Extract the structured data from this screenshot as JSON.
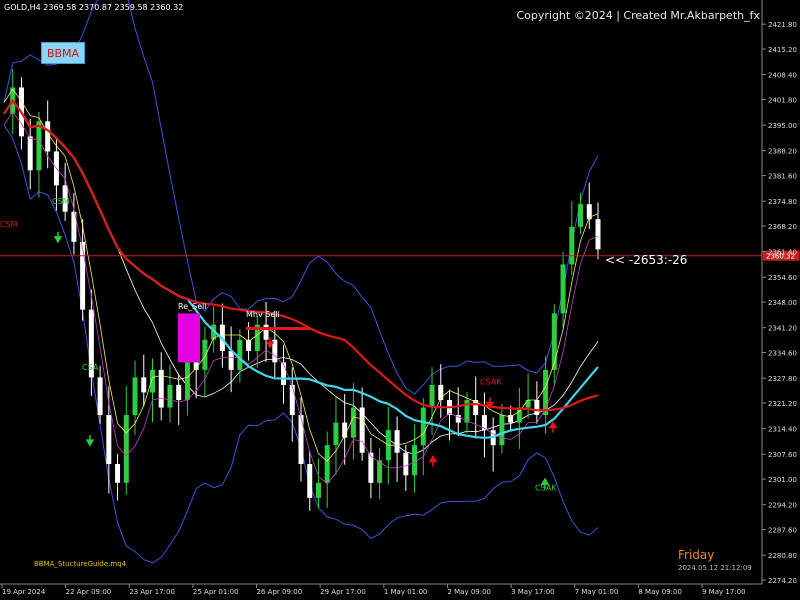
{
  "header": {
    "ohlc": "GOLD,H4 2369.58 2370.87 2359.58 2360.32",
    "copyright": "Copyright ©2024 | Created Mr.Akbarpeth_fx"
  },
  "bbma_button": "BBMA",
  "ea_name": "BBMA_StuctureGuide.mq4",
  "day_label": "Friday",
  "timestamp": "2024.05.12 21:12:09",
  "readout": "<< -2653:-26",
  "current_price": "2360.32",
  "colors": {
    "background": "#000000",
    "bull_candle": "#2ecc40",
    "bear_candle": "#ffffff",
    "bollinger": "#3a55d8",
    "ema50": "#40d8e8",
    "ma_long": "#e01818",
    "ma_fast_high": "#f0f060",
    "ma_fast_low": "#c040c0",
    "price_line": "#c81e1e"
  },
  "chart_data": {
    "type": "candlestick",
    "symbol": "GOLD",
    "timeframe": "H4",
    "ylim": [
      2274.2,
      2424.5
    ],
    "y_ticks": [
      "2421.80",
      "2415.20",
      "2408.40",
      "2401.80",
      "2395.00",
      "2388.20",
      "2381.60",
      "2374.80",
      "2368.20",
      "2361.40",
      "2354.60",
      "2348.00",
      "2341.20",
      "2334.60",
      "2327.80",
      "2321.20",
      "2314.40",
      "2307.60",
      "2301.00",
      "2294.20",
      "2287.60",
      "2280.80",
      "2274.20"
    ],
    "x_ticks": [
      "19 Apr 2024",
      "22 Apr 09:00",
      "23 Apr 17:00",
      "25 Apr 01:00",
      "26 Apr 09:00",
      "29 Apr 17:00",
      "1 May 01:00",
      "2 May 09:00",
      "3 May 17:00",
      "7 May 01:00",
      "8 May 09:00",
      "9 May 17:00"
    ],
    "close_path": [
      2398,
      2405,
      2392,
      2383,
      2396,
      2388,
      2379,
      2372,
      2364,
      2346,
      2328,
      2318,
      2305,
      2300,
      2318,
      2328,
      2324,
      2330,
      2320,
      2326,
      2322,
      2332,
      2330,
      2338,
      2342,
      2335,
      2330,
      2338,
      2335,
      2342,
      2338,
      2332,
      2326,
      2318,
      2305,
      2296,
      2300,
      2310,
      2316,
      2312,
      2320,
      2308,
      2300,
      2306,
      2314,
      2308,
      2302,
      2310,
      2320,
      2326,
      2322,
      2318,
      2316,
      2322,
      2318,
      2314,
      2310,
      2318,
      2316,
      2320,
      2322,
      2318,
      2330,
      2345,
      2358,
      2368,
      2374,
      2370,
      2362
    ],
    "annotations": [
      {
        "text": "Re_Sell",
        "price": 2344.6
      },
      {
        "text": "Mhv Sell",
        "price": 2340.8
      },
      {
        "text": "CSAK",
        "price": 2325.0
      },
      {
        "text": "CSAK",
        "price": 2298.0
      },
      {
        "text": "CSM",
        "price": 2368.0
      },
      {
        "text": "CSM",
        "price": 2374.0
      },
      {
        "text": "CSA",
        "price": 2330.0
      }
    ]
  }
}
